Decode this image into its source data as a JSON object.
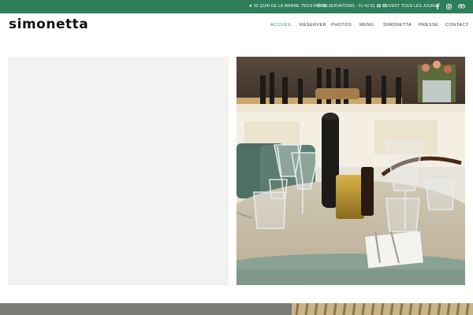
{
  "topbar": {
    "address": "32 QUAI DE LA MARNE 75019 PARIS",
    "reservations": "RESERVATIONS : 01 42 81 32 63",
    "hours": "OUVERT TOUS LES JOURS",
    "color": "#2e7d5b"
  },
  "header": {
    "logo": "simonetta",
    "nav": [
      {
        "label": "ACCUEIL",
        "active": true
      },
      {
        "label": "RÉSERVER",
        "active": false
      },
      {
        "label": "PHOTOS",
        "active": false
      },
      {
        "label": "MENU",
        "active": false
      },
      {
        "label": "SIMONETTA",
        "active": false
      },
      {
        "label": "PRESSE",
        "active": false
      },
      {
        "label": "CONTACT",
        "active": false
      }
    ]
  },
  "icons": {
    "address": "map-pin-icon",
    "phone": "phone-icon",
    "hours": "clock-icon",
    "social": [
      "facebook-icon",
      "instagram-icon",
      "tripadvisor-icon"
    ]
  }
}
